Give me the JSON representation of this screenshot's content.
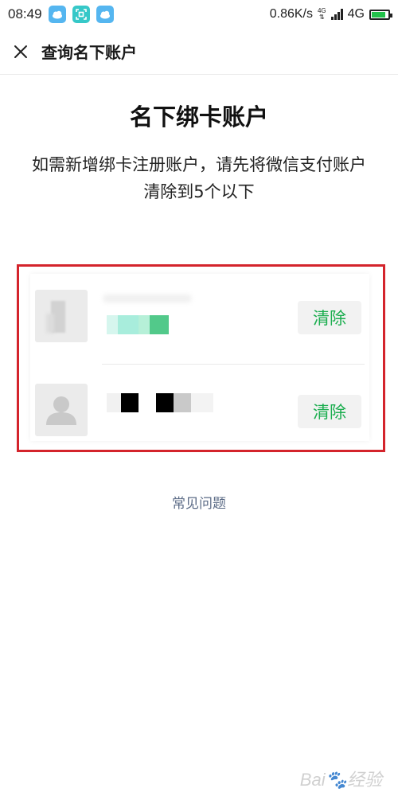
{
  "status_bar": {
    "time": "08:49",
    "app_icons": [
      "weather-icon",
      "scan-icon",
      "weather-icon"
    ],
    "network_speed": "0.86K/s",
    "network_type_small": "4G",
    "network_type": "4G",
    "battery_level": 0.85,
    "battery_color": "#22c24a"
  },
  "navbar": {
    "close_icon": "close-icon",
    "title": "查询名下账户"
  },
  "main": {
    "title": "名下绑卡账户",
    "description": "如需新增绑卡注册账户，请先将微信支付账户清除到5个以下"
  },
  "accounts": [
    {
      "avatar": "blurred-photo",
      "clear_label": "清除"
    },
    {
      "avatar": "default-person-icon",
      "clear_label": "清除"
    }
  ],
  "footer": {
    "faq_label": "常见问题"
  },
  "colors": {
    "accent_green": "#1aad4e",
    "highlight_red": "#d4242c",
    "link_color": "#5b6b86"
  }
}
